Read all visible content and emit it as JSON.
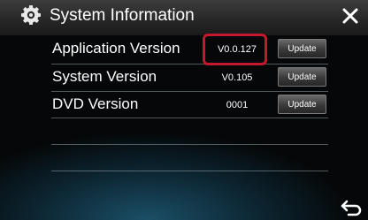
{
  "header": {
    "title": "System Information"
  },
  "rows": [
    {
      "label": "Application Version",
      "value": "V0.0.127",
      "button": "Update"
    },
    {
      "label": "System Version",
      "value": "V0.105",
      "button": "Update"
    },
    {
      "label": "DVD Version",
      "value": "0001",
      "button": "Update"
    }
  ],
  "colors": {
    "highlight": "#c4182c",
    "background_glow": "#1b4f67"
  }
}
